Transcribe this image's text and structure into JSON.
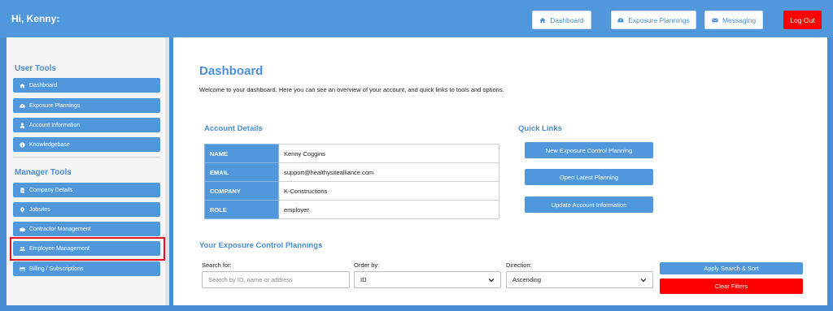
{
  "header": {
    "greeting": "Hi, Kenny:",
    "nav": [
      {
        "label": "Dashboard",
        "icon": "home-icon"
      },
      {
        "label": "Exposure Plannings",
        "icon": "dashboard-gauge-icon"
      },
      {
        "label": "Messaging",
        "icon": "envelope-icon"
      }
    ],
    "logout_label": "Log Out"
  },
  "sidebar": {
    "user_tools_title": "User Tools",
    "user_tools": [
      {
        "label": "Dashboard",
        "icon": "home-icon"
      },
      {
        "label": "Exposure Plannings",
        "icon": "dashboard-gauge-icon"
      },
      {
        "label": "Account Information",
        "icon": "user-icon"
      },
      {
        "label": "Knowledgebase",
        "icon": "info-circle-icon"
      }
    ],
    "manager_tools_title": "Manager Tools",
    "manager_tools": [
      {
        "label": "Company Details",
        "icon": "document-icon"
      },
      {
        "label": "Jobsites",
        "icon": "map-pin-icon"
      },
      {
        "label": "Contractor Management",
        "icon": "briefcase-icon"
      },
      {
        "label": "Employee Management",
        "icon": "users-icon"
      },
      {
        "label": "Billing / Subscriptions",
        "icon": "credit-card-icon"
      }
    ]
  },
  "main": {
    "title": "Dashboard",
    "intro": "Welcome to your dashboard. Here you can see an overview of your account, and quick links to tools and options.",
    "account_details_title": "Account Details",
    "account_details": [
      {
        "key": "NAME",
        "value": "Kenny Coggins"
      },
      {
        "key": "EMAIL",
        "value": "support@healthysitealliance.com"
      },
      {
        "key": "COMPANY",
        "value": "K-Constructions"
      },
      {
        "key": "ROLE",
        "value": "employer"
      }
    ],
    "quick_links_title": "Quick Links",
    "quick_links": [
      "New Exposure Control Planning",
      "Open Latest Planning",
      "Update Account Information"
    ],
    "plannings_title": "Your Exposure Control Plannings",
    "search": {
      "label": "Search for:",
      "placeholder": "Search by ID, name or address",
      "value": ""
    },
    "order_by": {
      "label": "Order by:",
      "selected": "ID"
    },
    "direction": {
      "label": "Direction:",
      "selected": "Ascending"
    },
    "apply_label": "Apply Search & Sort",
    "clear_label": "Clear Filters"
  },
  "colors": {
    "brand_blue": "#5197dc",
    "danger_red": "#ff0000",
    "highlight_red": "#e81123"
  }
}
